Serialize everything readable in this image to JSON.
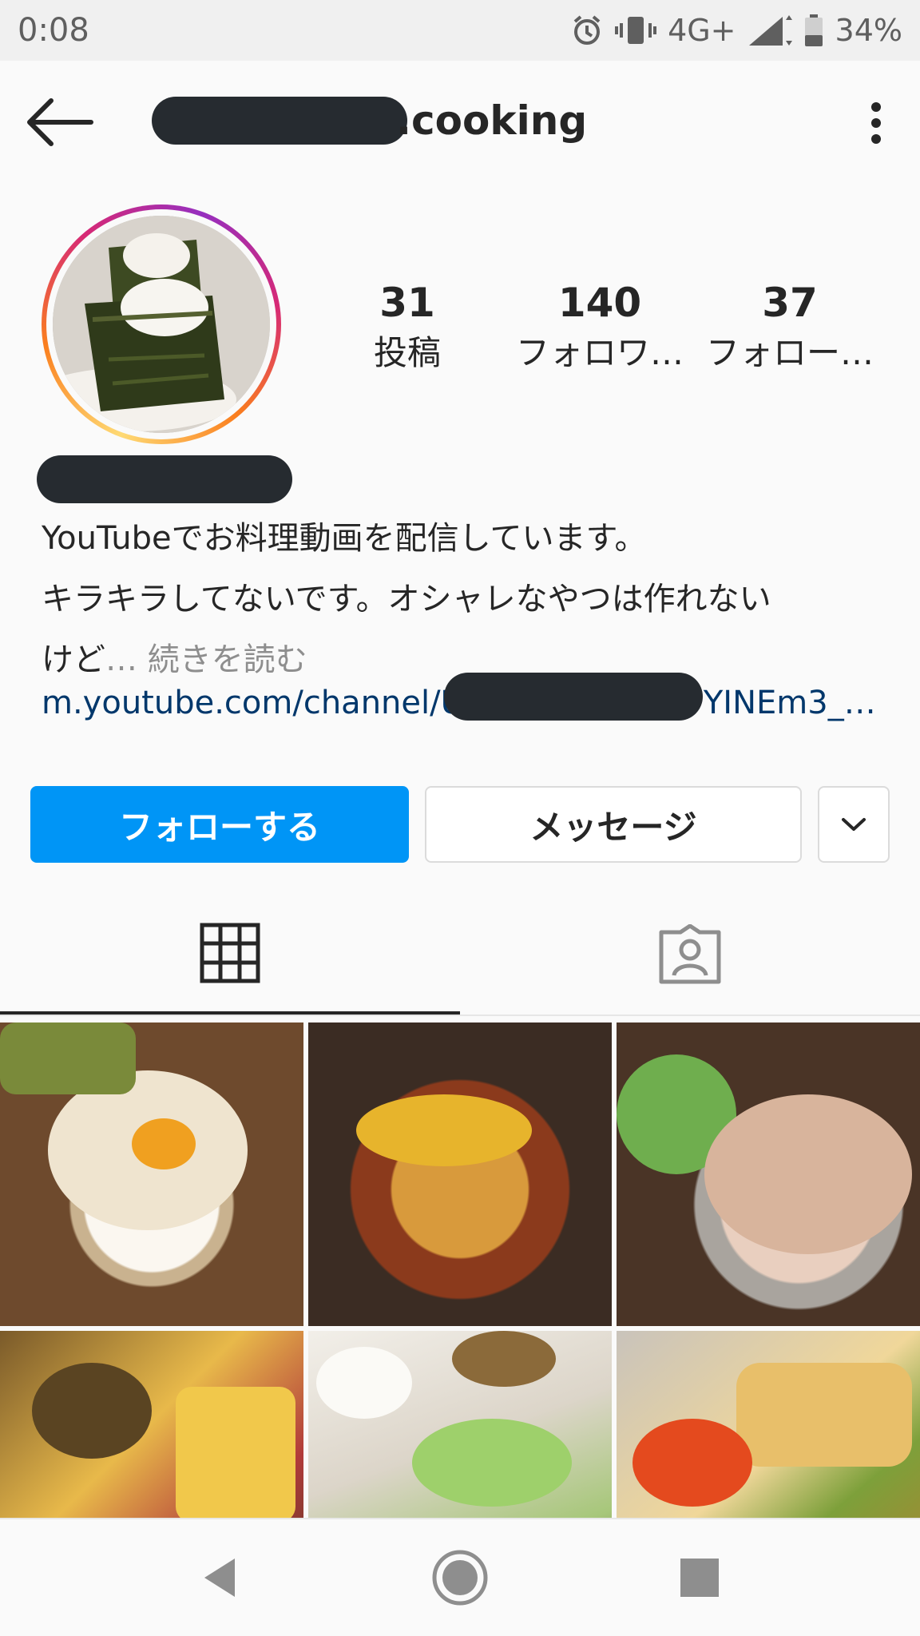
{
  "status_bar": {
    "time": "0:08",
    "network": "4G+",
    "battery": "34%",
    "icons": [
      "alarm-icon",
      "vibrate-icon",
      "signal-icon",
      "battery-icon"
    ]
  },
  "header": {
    "username": ".cooking",
    "icons": [
      "back-arrow-icon",
      "more-vert-icon"
    ]
  },
  "profile": {
    "stats": [
      {
        "value": "31",
        "label": "投稿"
      },
      {
        "value": "140",
        "label": "フォロワ…"
      },
      {
        "value": "37",
        "label": "フォロー…"
      }
    ],
    "bio_line1": "YouTubeでお料理動画を配信しています。",
    "bio_line2": "キラキラしてないです。オシャレなやつは作れない",
    "bio_line3": "けど",
    "bio_more": "… 続きを読む",
    "link_prefix": "m.youtube.com/channel/U",
    "link_suffix": "YINEm3_…"
  },
  "actions": {
    "follow": "フォローする",
    "message": "メッセージ",
    "dropdown_icon": "chevron-down-icon"
  },
  "tabs": [
    {
      "icon": "grid-icon",
      "active": true
    },
    {
      "icon": "tagged-user-icon",
      "active": false
    }
  ],
  "posts": [
    "post-1",
    "post-2",
    "post-3",
    "post-4",
    "post-5",
    "post-6"
  ],
  "nav": [
    "back-triangle-icon",
    "home-circle-icon",
    "recents-square-icon"
  ],
  "colors": {
    "accent": "#0095f6",
    "link": "#00376b",
    "text": "#262626",
    "muted": "#8e8e8e"
  }
}
